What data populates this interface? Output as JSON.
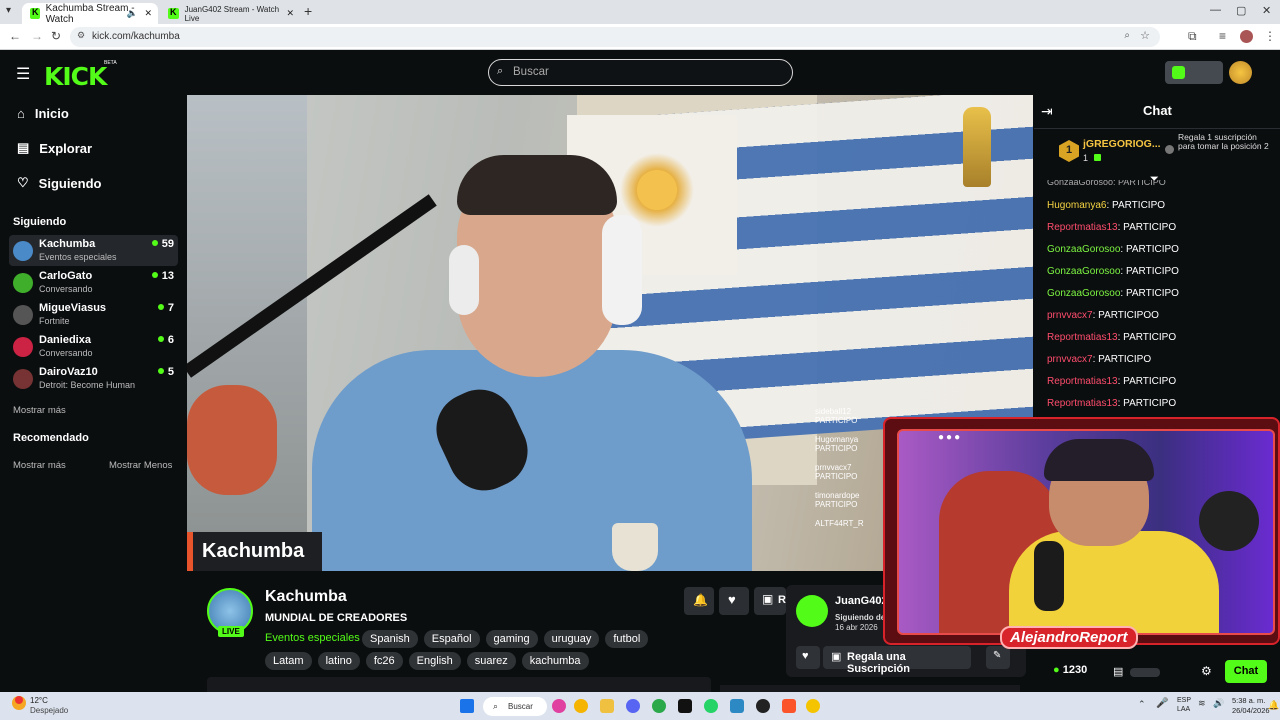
{
  "browser": {
    "tabs": [
      {
        "label": "Kachumba Stream - Watch"
      },
      {
        "label": "JuanG402 Stream - Watch Live"
      }
    ],
    "url": "kick.com/kachumba"
  },
  "topbar": {
    "logo": "KICK",
    "beta": "BETA",
    "search_placeholder": "Buscar"
  },
  "sidebar": {
    "nav": [
      {
        "label": "Inicio",
        "icon": "home-icon"
      },
      {
        "label": "Explorar",
        "icon": "explore-icon"
      },
      {
        "label": "Siguiendo",
        "icon": "heart-icon"
      }
    ],
    "following_title": "Siguiendo",
    "channels": [
      {
        "name": "Kachumba",
        "category": "Eventos especiales",
        "viewers": "59",
        "color": "#4a8ac8"
      },
      {
        "name": "CarloGato",
        "category": "Conversando",
        "viewers": "13",
        "color": "#3fae2a"
      },
      {
        "name": "MigueViasus",
        "category": "Fortnite",
        "viewers": "7",
        "color": "#555"
      },
      {
        "name": "Daniedixa",
        "category": "Conversando",
        "viewers": "6",
        "color": "#c24"
      },
      {
        "name": "DairoVaz10",
        "category": "Detroit: Become Human",
        "viewers": "5",
        "color": "#733"
      }
    ],
    "show_more": "Mostrar más",
    "recommended_title": "Recomendado",
    "show_more2": "Mostrar más",
    "show_less": "Mostrar Menos"
  },
  "stream": {
    "overlay_name": "Kachumba",
    "channel": "Kachumba",
    "title": "MUNDIAL DE CREADORES",
    "live": "LIVE",
    "category": "Eventos especiales",
    "tags": [
      "Spanish",
      "Español",
      "gaming",
      "uruguay",
      "futbol",
      "Latam",
      "latino",
      "fc26",
      "English",
      "suarez",
      "kachumba"
    ],
    "subscribe_partial": "R"
  },
  "video_chat": [
    {
      "name": "sideball12",
      "text": "PARTICIPO"
    },
    {
      "name": "Hugomanya",
      "text": "PARTICIPO"
    },
    {
      "name": "prnvvacx7",
      "text": "PARTICIPO"
    },
    {
      "name": "timonardope",
      "text": "PARTICIPO"
    },
    {
      "name": "ALTF44RT_R",
      "text": ""
    }
  ],
  "chat": {
    "title": "Chat",
    "leader": {
      "rank": "1",
      "name": "jGREGORIOG...",
      "count": "1"
    },
    "gift_prompt": "Regala 1 suscripción para tomar la posición 2",
    "partial_top": "GonzaaGorosoo: PARTICIPO",
    "messages": [
      {
        "user": "Hugomanya6",
        "text": "PARTICIPO",
        "color": "#f5d442"
      },
      {
        "user": "Reportmatias13",
        "text": "PARTICIPO",
        "color": "#ff4d6d"
      },
      {
        "user": "GonzaaGorosoo",
        "text": "PARTICIPO",
        "color": "#7cf542"
      },
      {
        "user": "GonzaaGorosoo",
        "text": "PARTICIPO",
        "color": "#7cf542"
      },
      {
        "user": "GonzaaGorosoo",
        "text": "PARTICIPO",
        "color": "#7cf542"
      },
      {
        "user": "prnvvacx7",
        "text": "PARTICIPOO",
        "color": "#ff4d6d"
      },
      {
        "user": "Reportmatias13",
        "text": "PARTICIPO",
        "color": "#ff4d6d"
      },
      {
        "user": "prnvvacx7",
        "text": "PARTICIPO",
        "color": "#ff4d6d"
      },
      {
        "user": "Reportmatias13",
        "text": "PARTICIPO",
        "color": "#ff4d6d"
      },
      {
        "user": "Reportmatias13",
        "text": "PARTICIPO",
        "color": "#ff4d6d"
      }
    ],
    "points": "1230",
    "send_label": "Chat"
  },
  "popup": {
    "name": "JuanG402",
    "following_since": "Siguiendo des",
    "date": "16 abr 2026",
    "gift_label": "Regala una Suscripción"
  },
  "pip": {
    "brand": "AlejandroReport"
  },
  "taskbar": {
    "temp": "12°C",
    "weather": "Despejado",
    "search": "Buscar",
    "lang1": "ESP",
    "lang2": "LAA",
    "time": "5:38 a. m.",
    "date": "26/04/2026"
  }
}
